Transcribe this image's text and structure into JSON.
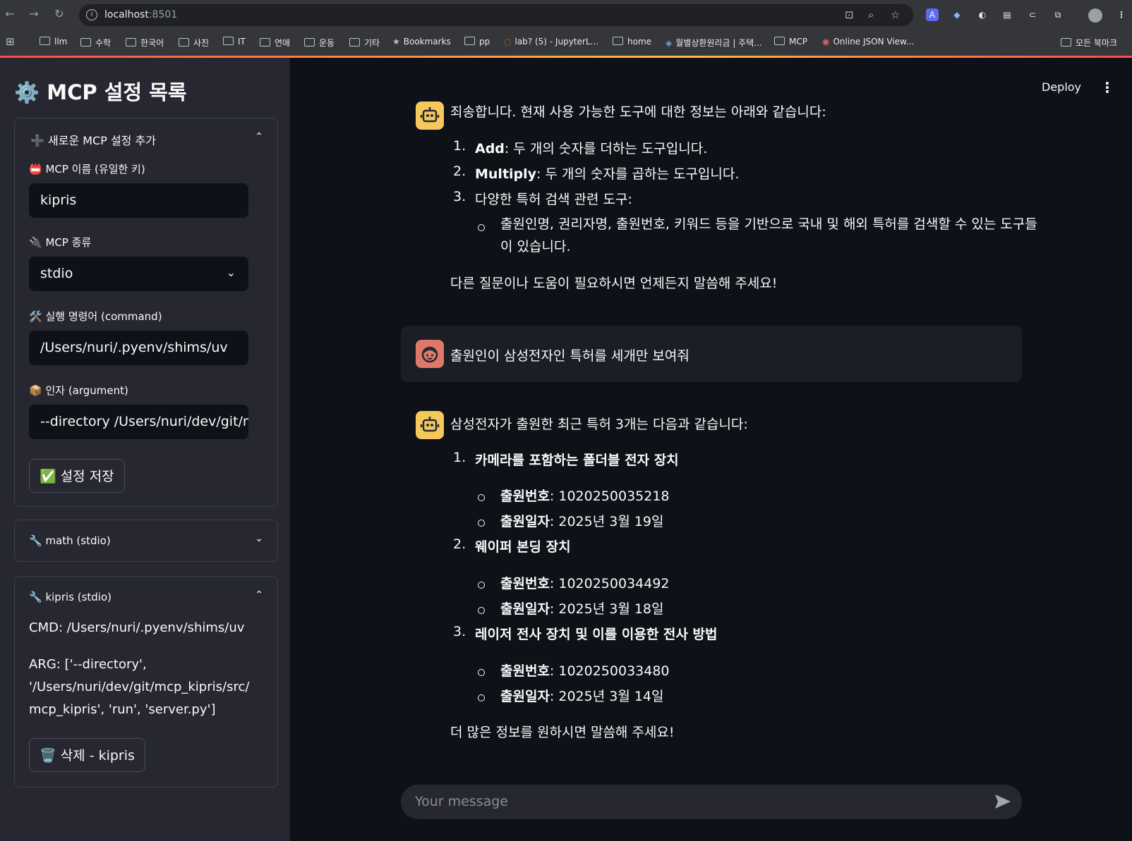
{
  "browser": {
    "url_host": "localhost",
    "url_port": ":8501",
    "bookmarks": [
      "llm",
      "수학",
      "한국어",
      "사진",
      "IT",
      "연애",
      "운동",
      "기타",
      "Bookmarks",
      "pp",
      "lab? (5) - JupyterL...",
      "home",
      "월별상환원리금 | 주택...",
      "MCP",
      "Online JSON View...",
      "모든 북마크"
    ]
  },
  "sidebar": {
    "title": "⚙️ MCP 설정 목록",
    "add_expander": {
      "header": "➕ 새로운 MCP 설정 추가",
      "name_label": "📛 MCP 이름 (유일한 키)",
      "name_value": "kipris",
      "type_label": "🔌 MCP 종류",
      "type_value": "stdio",
      "command_label": "🛠️ 실행 명령어 (command)",
      "command_value": "/Users/nuri/.pyenv/shims/uv",
      "arg_label": "📦 인자 (argument)",
      "arg_value": "--directory /Users/nuri/dev/git/mc",
      "save_button": "✅ 설정 저장"
    },
    "math_expander": {
      "header": "🔧 math (stdio)"
    },
    "kipris_expander": {
      "header": "🔧 kipris (stdio)",
      "cmd": "CMD: /Users/nuri/.pyenv/shims/uv",
      "arg_line1": "ARG: ['--directory',",
      "arg_line2": "'/Users/nuri/dev/git/mcp_kipris/src/",
      "arg_line3": "mcp_kipris', 'run', 'server.py']",
      "delete_button": "🗑️ 삭제 - kipris"
    }
  },
  "header": {
    "deploy": "Deploy",
    "menu": "⋮"
  },
  "chat": {
    "msg1": {
      "intro": "죄송합니다. 현재 사용 가능한 도구에 대한 정보는 아래와 같습니다:",
      "items": [
        {
          "num": "1.",
          "bold": "Add",
          "text": ": 두 개의 숫자를 더하는 도구입니다."
        },
        {
          "num": "2.",
          "bold": "Multiply",
          "text": ": 두 개의 숫자를 곱하는 도구입니다."
        },
        {
          "num": "3.",
          "bold": "",
          "text": "다양한 특허 검색 관련 도구:"
        }
      ],
      "sub_line1": "출원인명, 권리자명, 출원번호, 키워드 등을 기반으로 국내 및 해외 특허를 검색할 수 있는 도구들",
      "sub_line2": "이 있습니다.",
      "outro": "다른 질문이나 도움이 필요하시면 언제든지 말씀해 주세요!"
    },
    "user_msg": "출원인이 삼성전자인 특허를 세개만 보여줘",
    "msg2": {
      "intro": "삼성전자가 출원한 최근 특허 3개는 다음과 같습니다:",
      "patents": [
        {
          "num": "1.",
          "title": "카메라를 포함하는 폴더블 전자 장치",
          "app_no_label": "출원번호",
          "app_no": ": 1020250035218",
          "date_label": "출원일자",
          "date": ": 2025년 3월 19일"
        },
        {
          "num": "2.",
          "title": "웨이퍼 본딩 장치",
          "app_no_label": "출원번호",
          "app_no": ": 1020250034492",
          "date_label": "출원일자",
          "date": ": 2025년 3월 18일"
        },
        {
          "num": "3.",
          "title": "레이저 전사 장치 및 이를 이용한 전사 방법",
          "app_no_label": "출원번호",
          "app_no": ": 1020250033480",
          "date_label": "출원일자",
          "date": ": 2025년 3월 14일"
        }
      ],
      "outro": "더 많은 정보를 원하시면 말씀해 주세요!"
    },
    "input_placeholder": "Your message"
  }
}
